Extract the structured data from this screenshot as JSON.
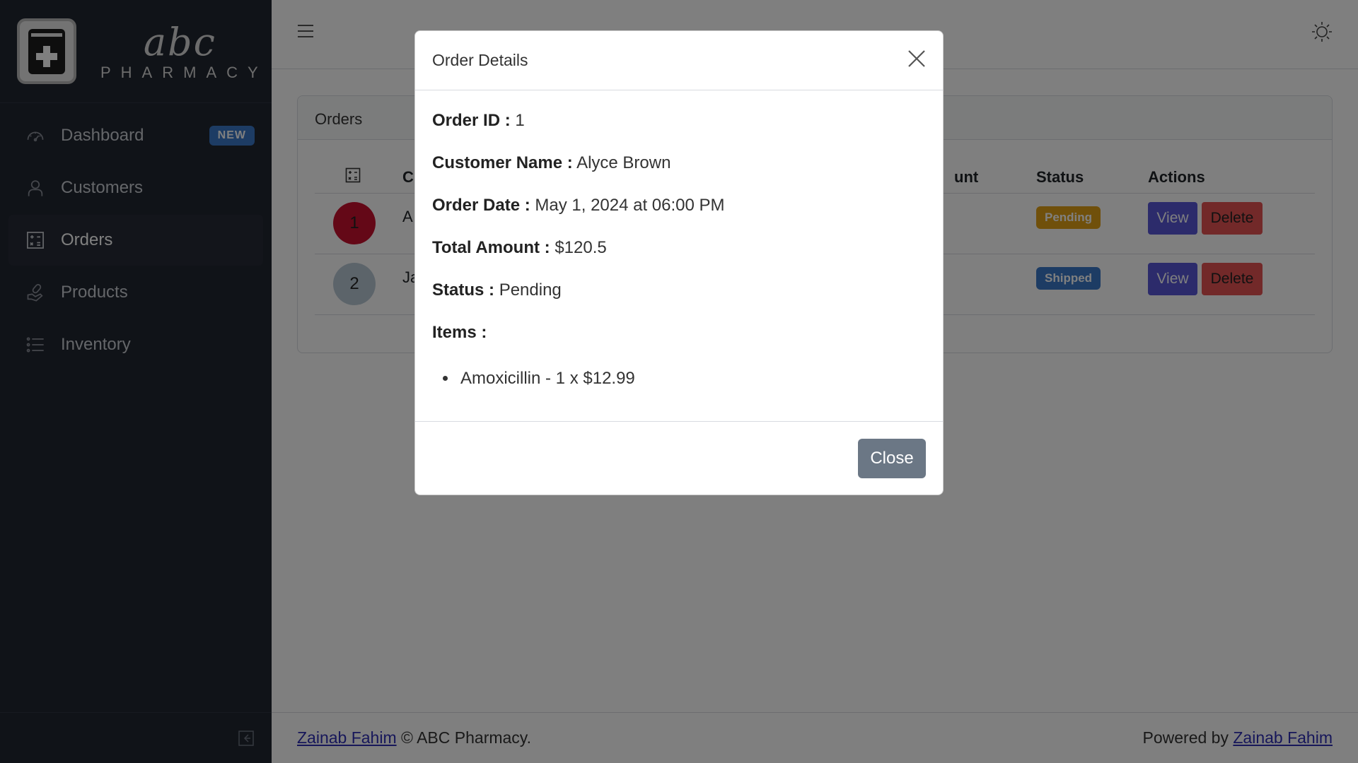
{
  "brand": {
    "logo_text": "abc",
    "logo_subtext": "PHARMACY"
  },
  "sidebar": {
    "items": [
      {
        "label": "Dashboard",
        "icon": "speedometer-icon",
        "badge": "NEW"
      },
      {
        "label": "Customers",
        "icon": "user-icon"
      },
      {
        "label": "Orders",
        "icon": "calculator-icon",
        "active": true
      },
      {
        "label": "Products",
        "icon": "pill-hand-icon"
      },
      {
        "label": "Inventory",
        "icon": "list-icon"
      }
    ]
  },
  "orders_card": {
    "title": "Orders",
    "headers": {
      "col2": "C",
      "amount": "unt",
      "status": "Status",
      "actions": "Actions"
    },
    "rows": [
      {
        "index": "1",
        "name": "A",
        "status": "Pending",
        "view": "View",
        "delete": "Delete"
      },
      {
        "index": "2",
        "name": "Ja",
        "status": "Shipped",
        "view": "View",
        "delete": "Delete"
      }
    ]
  },
  "modal": {
    "title": "Order Details",
    "fields": [
      {
        "label": "Order ID :",
        "value": "1"
      },
      {
        "label": "Customer Name :",
        "value": "Alyce Brown"
      },
      {
        "label": "Order Date :",
        "value": "May 1, 2024 at 06:00 PM"
      },
      {
        "label": "Total Amount :",
        "value": "$120.5"
      },
      {
        "label": "Status :",
        "value": "Pending"
      }
    ],
    "items_label": "Items :",
    "items": [
      "Amoxicillin - 1 x $12.99"
    ],
    "close_label": "Close"
  },
  "footer": {
    "left_link": "Zainab Fahim",
    "left_text": "© ABC Pharmacy.",
    "right_text": "Powered by",
    "right_link": "Zainab Fahim"
  },
  "colors": {
    "sidebar_bg": "#212631",
    "badge_new": "#3a78c9",
    "pending": "#e1a116",
    "shipped": "#3a78c9",
    "view_btn": "#5856d6",
    "delete_btn": "#e55353",
    "avatar1": "#c8102e",
    "avatar2": "#b9c8d4"
  }
}
